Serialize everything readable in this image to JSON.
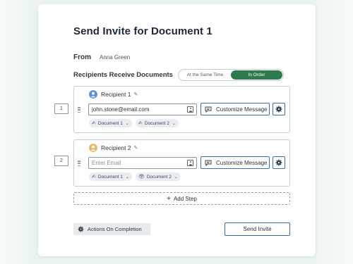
{
  "dialog": {
    "title": "Send Invite for Document 1",
    "from_label": "From",
    "from_name": "Anna Green",
    "order_label": "Recipients Receive Documents",
    "order_options": [
      {
        "label": "At the Same Time",
        "active": false
      },
      {
        "label": "In Order",
        "active": true
      }
    ]
  },
  "steps": [
    {
      "number": "1",
      "recipient_label": "Recipient 1",
      "avatar_color": "#5b8fd6",
      "email_value": "john.stone@email.com",
      "email_placeholder": "Enter Email",
      "customize_label": "Customize Message",
      "chips": [
        {
          "icon": "edit-doc-icon",
          "label": "Document 1"
        },
        {
          "icon": "edit-doc-icon",
          "label": "Document 2"
        }
      ]
    },
    {
      "number": "2",
      "recipient_label": "Recipient 2",
      "avatar_color": "#e8b86a",
      "email_value": "",
      "email_placeholder": "Enter Email",
      "customize_label": "Customize Message",
      "chips": [
        {
          "icon": "edit-doc-icon",
          "label": "Document 1"
        },
        {
          "icon": "view-icon",
          "label": "Document 2"
        }
      ]
    }
  ],
  "add_step_label": "Add Step",
  "actions_label": "Actions On Completion",
  "send_label": "Send Invite",
  "colors": {
    "accent_green": "#2f7a4f",
    "accent_blue": "#3a6fa8"
  }
}
